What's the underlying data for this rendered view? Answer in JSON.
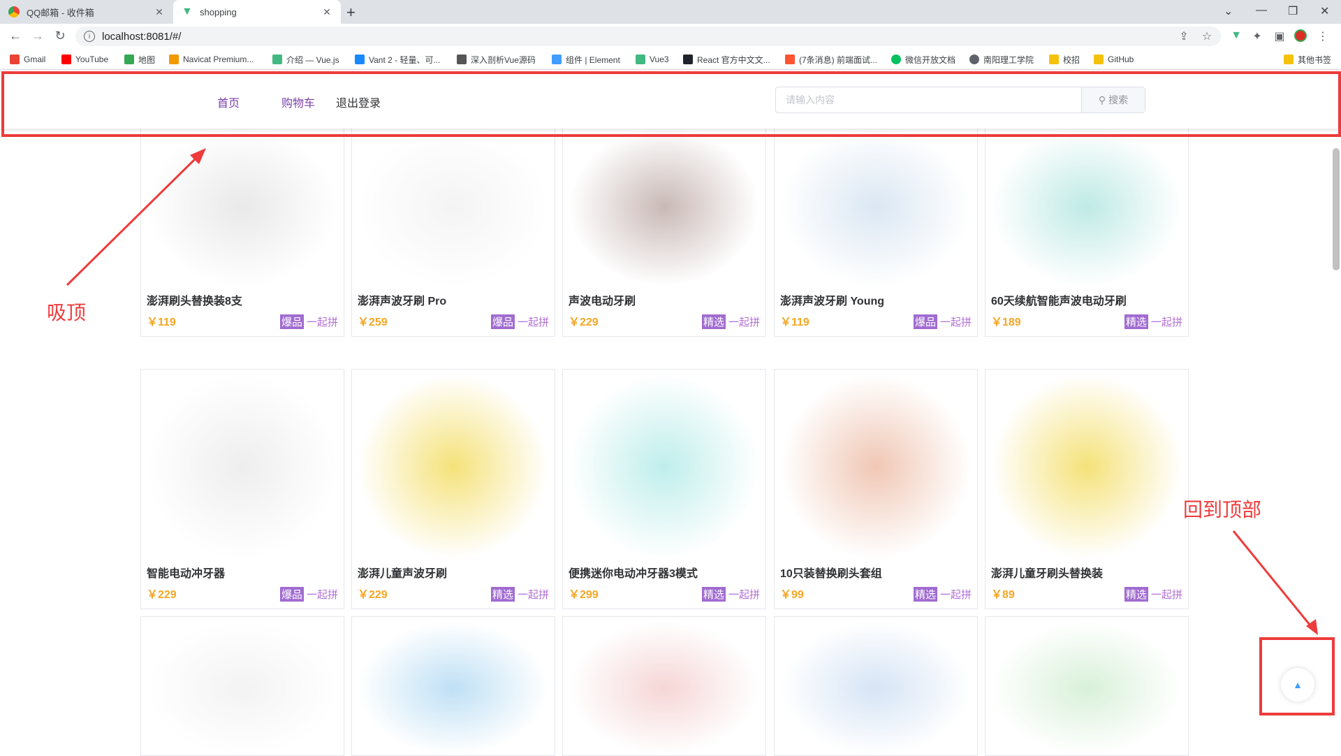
{
  "browser": {
    "tabs": [
      {
        "title": "QQ邮箱 - 收件箱",
        "close": "✕"
      },
      {
        "title": "shopping",
        "close": "✕"
      }
    ],
    "new_tab": "+",
    "window_controls": [
      "⌄",
      "—",
      "❐",
      "✕"
    ],
    "url": "localhost:8081/#/",
    "bookmarks": [
      {
        "label": "Gmail",
        "color": "#ea4335"
      },
      {
        "label": "YouTube",
        "color": "#ff0000"
      },
      {
        "label": "地图",
        "color": "#34a853"
      },
      {
        "label": "Navicat Premium...",
        "color": "#f29900"
      },
      {
        "label": "介绍 — Vue.js",
        "color": "#42b883"
      },
      {
        "label": "Vant 2 - 轻量、可...",
        "color": "#1989fa"
      },
      {
        "label": "深入剖析Vue源码",
        "color": "#555555"
      },
      {
        "label": "组件 | Element",
        "color": "#409eff"
      },
      {
        "label": "Vue3",
        "color": "#42b883"
      },
      {
        "label": "React 官方中文文...",
        "color": "#20232a"
      },
      {
        "label": "(7条消息) 前端面试...",
        "color": "#fc5531"
      },
      {
        "label": "微信开放文档",
        "color": "#07c160"
      },
      {
        "label": "南阳理工学院",
        "color": "#5f6368"
      },
      {
        "label": "校招",
        "color": "#f4c20d"
      },
      {
        "label": "GitHub",
        "color": "#f4c20d"
      }
    ],
    "other_bookmarks": "其他书签"
  },
  "header": {
    "nav": [
      "首页",
      "购物车",
      "退出登录"
    ],
    "search_placeholder": "请输入内容",
    "search_button": "搜索"
  },
  "annotations": {
    "sticky_label": "吸顶",
    "back_to_top_label": "回到顶部"
  },
  "products": [
    {
      "name": "澎湃刷头替换装8支",
      "price": "￥119",
      "tag": "爆品",
      "group": "一起拼"
    },
    {
      "name": "澎湃声波牙刷 Pro",
      "price": "￥259",
      "tag": "爆品",
      "group": "一起拼"
    },
    {
      "name": "声波电动牙刷",
      "price": "￥229",
      "tag": "精选",
      "group": "一起拼"
    },
    {
      "name": "澎湃声波牙刷 Young",
      "price": "￥119",
      "tag": "爆品",
      "group": "一起拼"
    },
    {
      "name": "60天续航智能声波电动牙刷",
      "price": "￥189",
      "tag": "精选",
      "group": "一起拼"
    },
    {
      "name": "智能电动冲牙器",
      "price": "￥229",
      "tag": "爆品",
      "group": "一起拼"
    },
    {
      "name": "澎湃儿童声波牙刷",
      "price": "￥229",
      "tag": "精选",
      "group": "一起拼"
    },
    {
      "name": "便携迷你电动冲牙器3模式",
      "price": "￥299",
      "tag": "精选",
      "group": "一起拼"
    },
    {
      "name": "10只装替换刷头套组",
      "price": "￥99",
      "tag": "精选",
      "group": "一起拼"
    },
    {
      "name": "澎湃儿童牙刷头替换装",
      "price": "￥89",
      "tag": "精选",
      "group": "一起拼"
    },
    {
      "name": "",
      "price": "",
      "tag": "",
      "group": ""
    },
    {
      "name": "",
      "price": "",
      "tag": "",
      "group": ""
    },
    {
      "name": "",
      "price": "",
      "tag": "",
      "group": ""
    },
    {
      "name": "",
      "price": "",
      "tag": "",
      "group": ""
    },
    {
      "name": "",
      "price": "",
      "tag": "",
      "group": ""
    }
  ]
}
